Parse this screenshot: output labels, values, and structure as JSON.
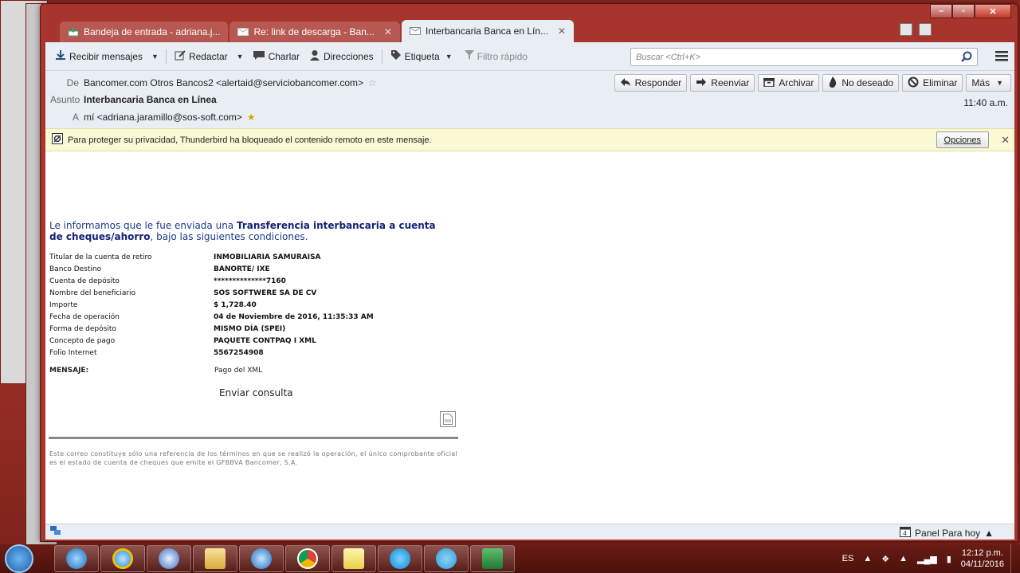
{
  "tabs": [
    {
      "label": "Bandeja de entrada - adriana.j...",
      "icon": "inbox-icon"
    },
    {
      "label": "Re: link de descarga - Ban...",
      "icon": "mail-icon"
    },
    {
      "label": "Interbancaria Banca en Lín...",
      "icon": "mail-icon"
    }
  ],
  "toolbar": {
    "get_messages": "Recibir mensajes",
    "write": "Redactar",
    "chat": "Charlar",
    "address": "Direcciones",
    "tag": "Etiqueta",
    "quick_filter": "Filtro rápido",
    "search_placeholder": "Buscar <Ctrl+K>"
  },
  "header": {
    "from_label": "De",
    "from": "Bancomer.com Otros Bancos2 <alertaid@serviciobancomer.com>",
    "subject_label": "Asunto",
    "subject": "Interbancaria Banca en Línea",
    "to_label": "A",
    "to": "mí <adriana.jaramillo@sos-soft.com>",
    "time": "11:40 a.m.",
    "buttons": {
      "reply": "Responder",
      "forward": "Reenviar",
      "archive": "Archivar",
      "junk": "No deseado",
      "delete": "Eliminar",
      "more": "Más"
    }
  },
  "notice": {
    "text": "Para proteger su privacidad, Thunderbird ha bloqueado el contenido remoto en este mensaje.",
    "options": "Opciones"
  },
  "message": {
    "intro_1": "Le informamos que le fue enviada una ",
    "intro_bold": "Transferencia interbancaria a cuenta de cheques/ahorro",
    "intro_2": ", bajo las siguientes condiciones.",
    "rows": [
      {
        "label": "Titular de la cuenta de retiro",
        "value": "INMOBILIARIA SAMURAISA"
      },
      {
        "label": "Banco Destino",
        "value": "BANORTE/ IXE"
      },
      {
        "label": "Cuenta de depósito",
        "value": "**************7160"
      },
      {
        "label": "Nombre del beneficiario",
        "value": "SOS SOFTWERE SA DE CV"
      },
      {
        "label": "Importe",
        "value": "$ 1,728.40"
      },
      {
        "label": "Fecha de operación",
        "value": "04 de Noviembre de 2016, 11:35:33 AM"
      },
      {
        "label": "Forma de depósito",
        "value": "MISMO DÍA (SPEI)"
      },
      {
        "label": "Concepto de pago",
        "value": "PAQUETE CONTPAQ I XML"
      },
      {
        "label": "Folio Internet",
        "value": "5567254908"
      }
    ],
    "message_label": "MENSAJE:",
    "message_value": "Pago del XML",
    "send_query": "Enviar consulta",
    "footer": "Este correo constituye sólo una referencia de los términos en que se realizó la operación, el único comprobante oficial es el estado de cuenta de cheques que emite el GFBBVA Bancomer, S.A."
  },
  "status": {
    "today_pane": "Panel Para hoy"
  },
  "taskbar": {
    "lang": "ES",
    "time": "12:12 p.m.",
    "date": "04/11/2016"
  }
}
